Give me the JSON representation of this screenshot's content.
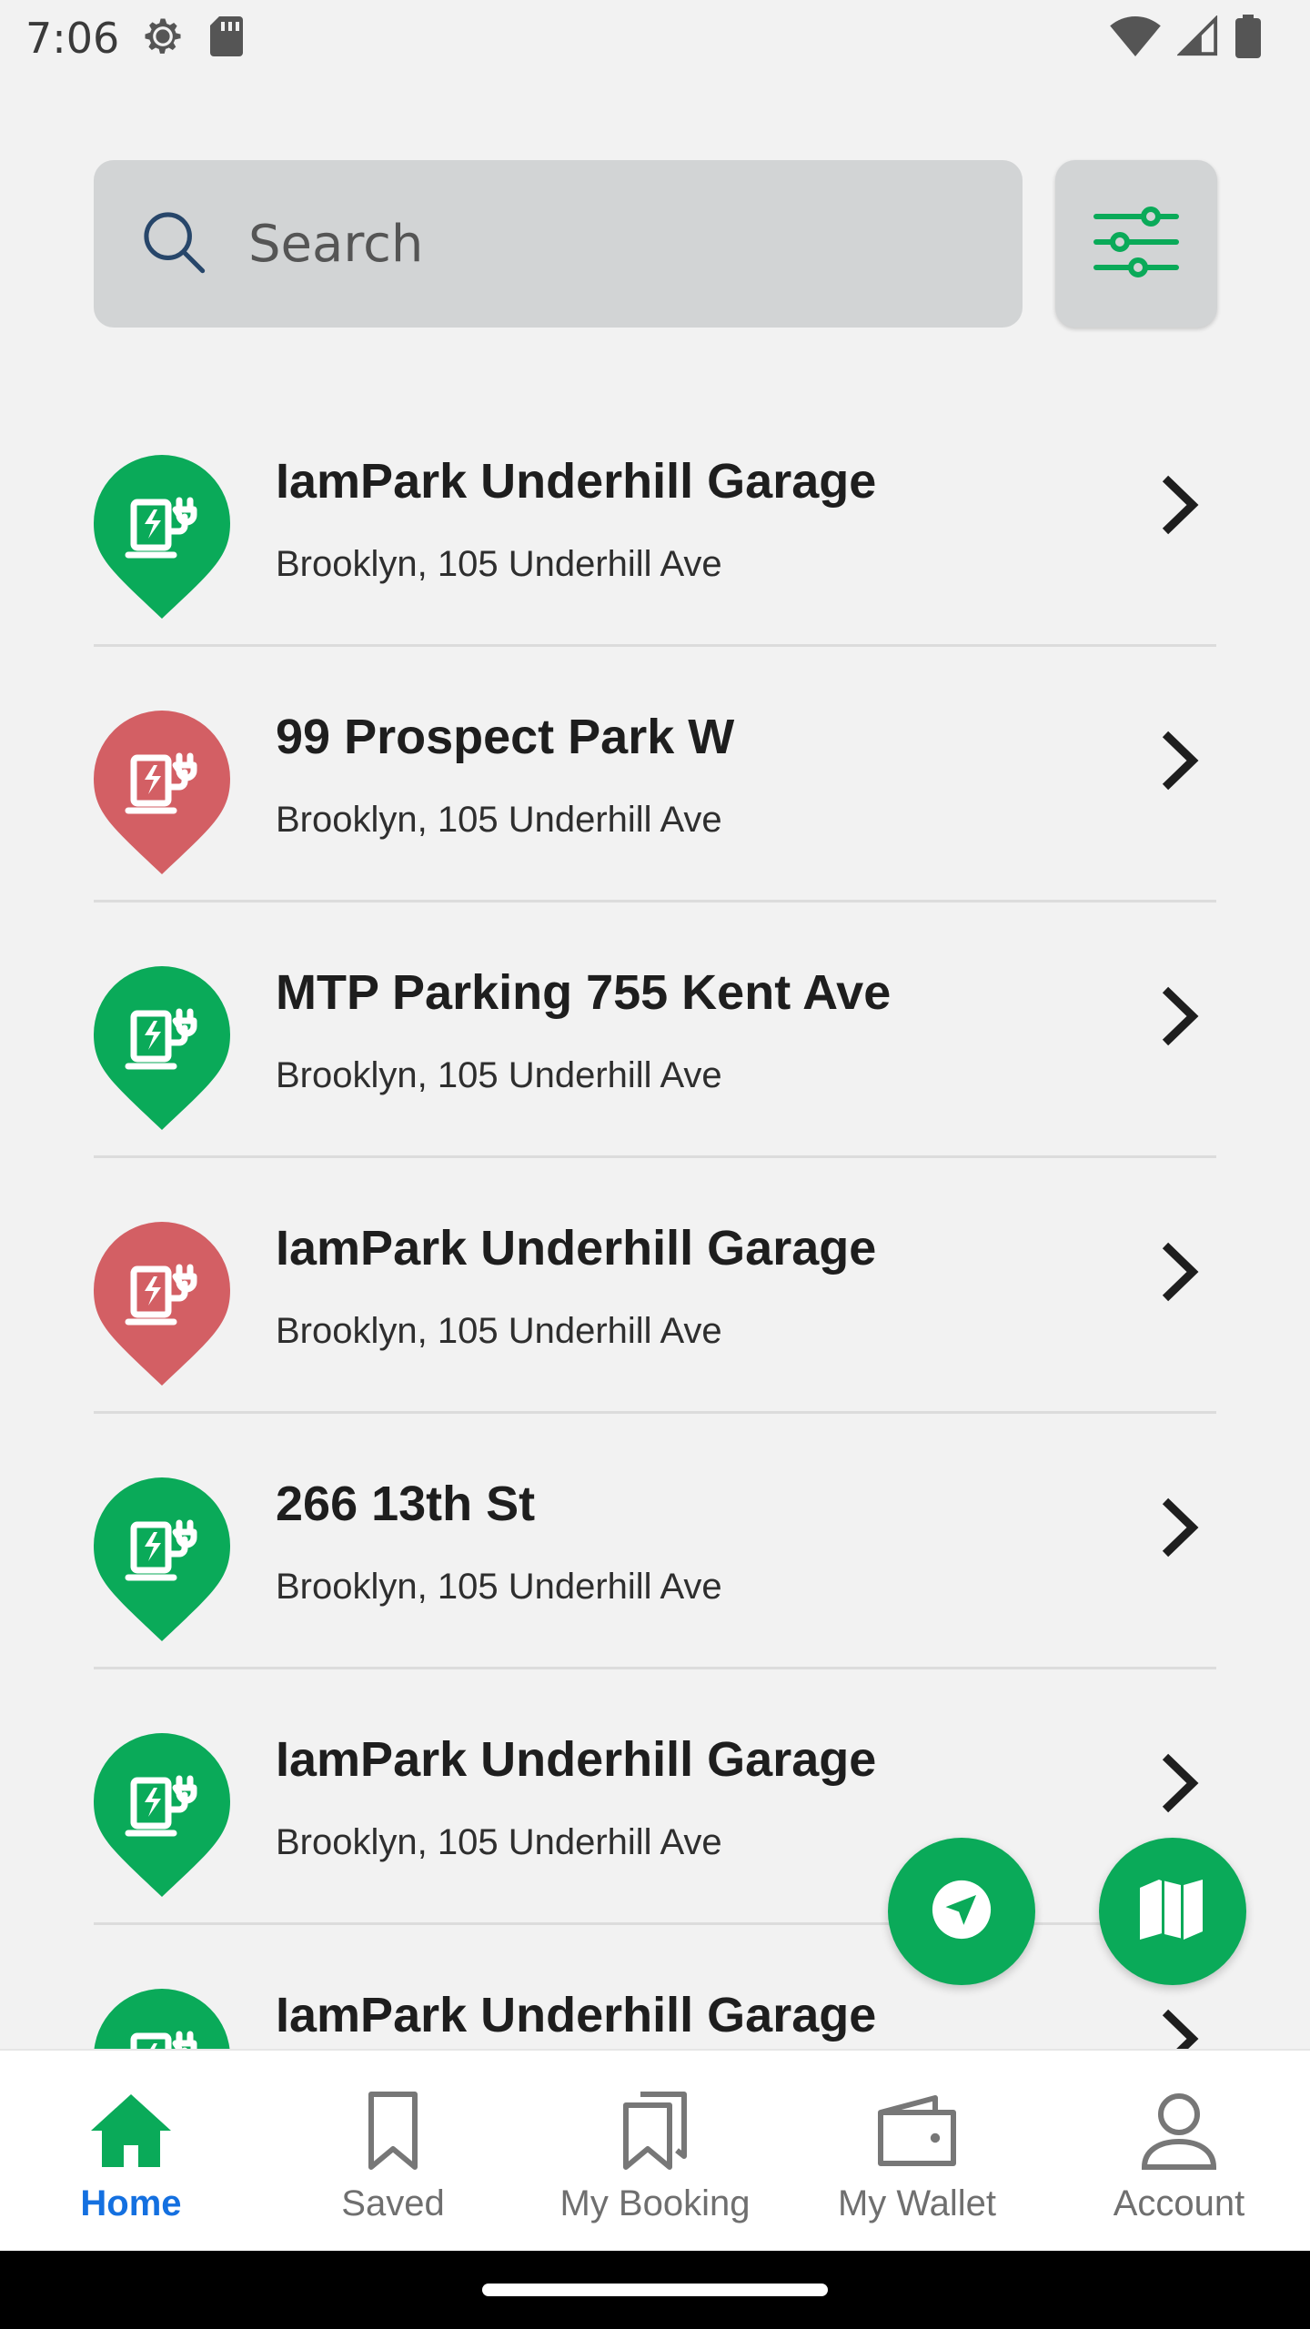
{
  "status_bar": {
    "time": "7:06",
    "icons": [
      "settings-gear-icon",
      "sd-card-icon",
      "wifi-icon",
      "signal-icon",
      "battery-icon"
    ]
  },
  "search": {
    "placeholder": "Search",
    "value": ""
  },
  "filter": {
    "icon": "sliders-icon"
  },
  "colors": {
    "green": "#0aaa59",
    "red": "#d35f64",
    "active_nav": "#1470e0",
    "background": "#f2f2f2"
  },
  "stations": [
    {
      "name": "IamPark Underhill Garage",
      "address": "Brooklyn, 105 Underhill Ave",
      "status": "green"
    },
    {
      "name": "99 Prospect Park W",
      "address": "Brooklyn, 105 Underhill Ave",
      "status": "red"
    },
    {
      "name": "MTP Parking 755 Kent Ave",
      "address": "Brooklyn, 105 Underhill Ave",
      "status": "green"
    },
    {
      "name": "IamPark Underhill Garage",
      "address": "Brooklyn, 105 Underhill Ave",
      "status": "red"
    },
    {
      "name": "266 13th St",
      "address": "Brooklyn, 105 Underhill Ave",
      "status": "green"
    },
    {
      "name": "IamPark Underhill Garage",
      "address": "Brooklyn, 105 Underhill Ave",
      "status": "green"
    },
    {
      "name": "IamPark Underhill Garage",
      "address": "",
      "status": "green"
    }
  ],
  "fabs": {
    "locate_icon": "navigation-arrow-icon",
    "map_icon": "map-icon"
  },
  "bottom_nav": {
    "items": [
      {
        "label": "Home",
        "icon": "home-icon",
        "active": true
      },
      {
        "label": "Saved",
        "icon": "bookmark-icon",
        "active": false
      },
      {
        "label": "My Booking",
        "icon": "bookmarks-icon",
        "active": false
      },
      {
        "label": "My Wallet",
        "icon": "wallet-icon",
        "active": false
      },
      {
        "label": "Account",
        "icon": "user-icon",
        "active": false
      }
    ]
  }
}
